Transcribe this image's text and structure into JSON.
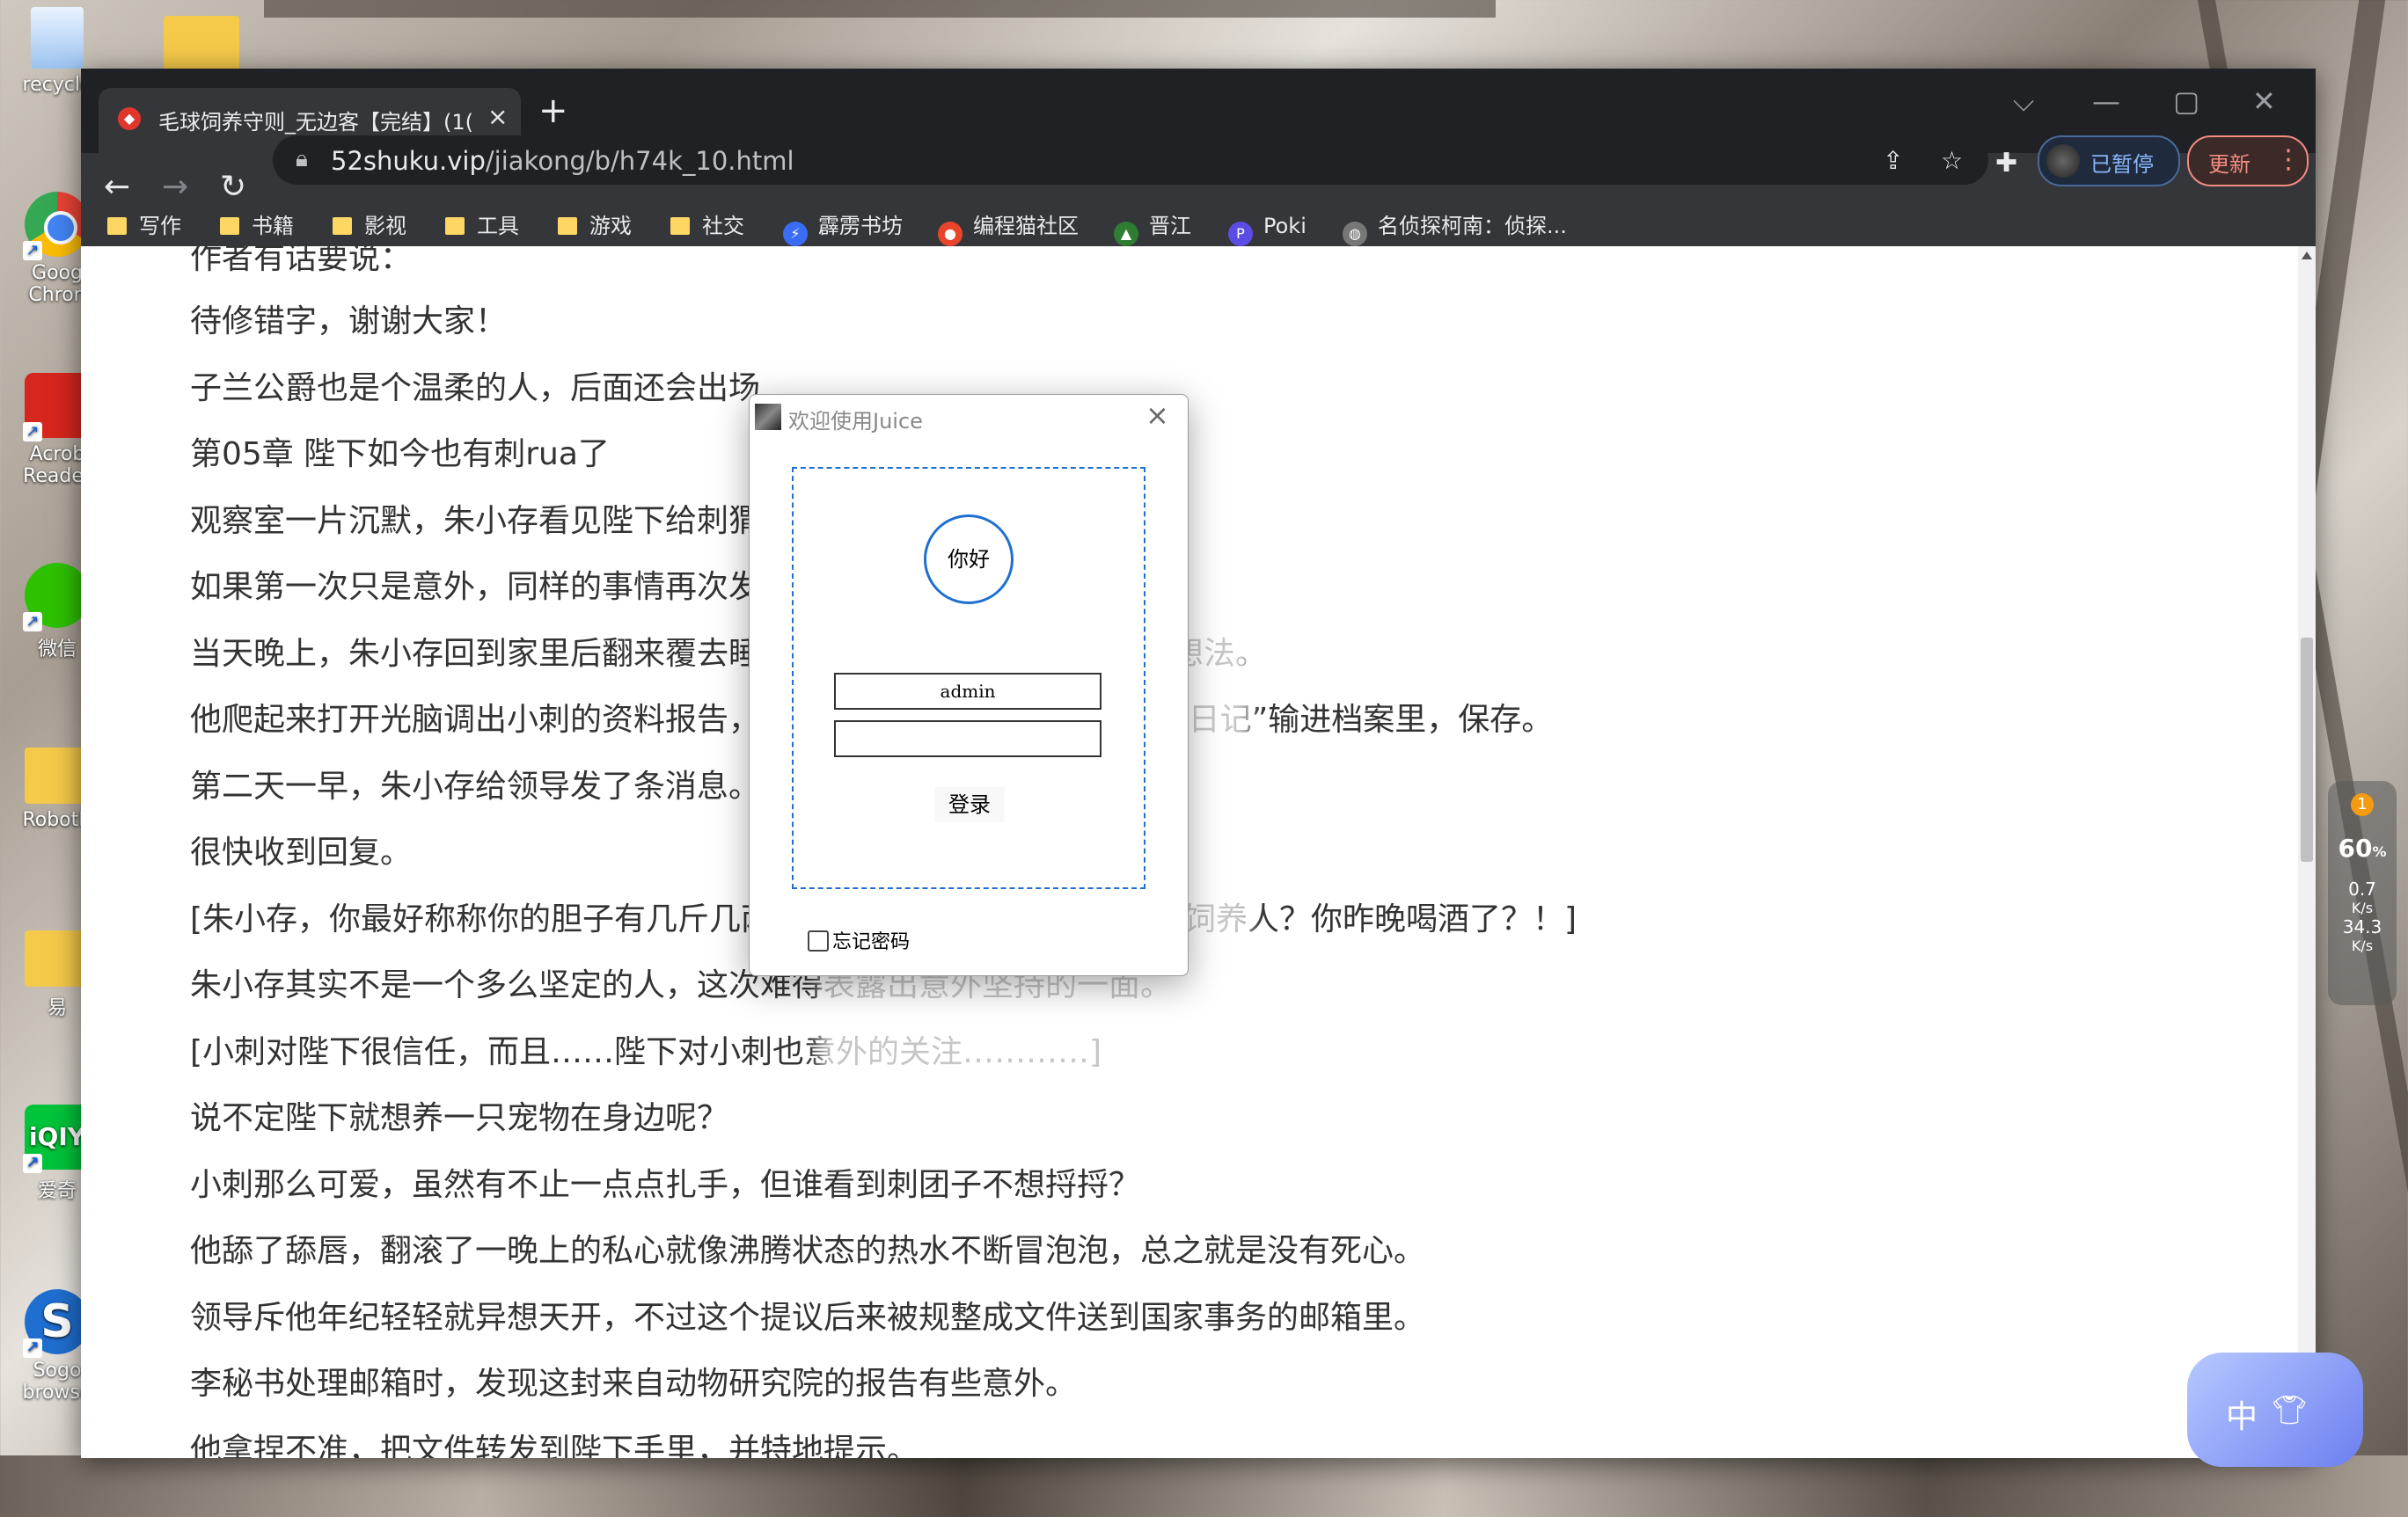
{
  "desktop": {
    "icons": [
      {
        "label": "recycle",
        "icon": "recycle-bin-icon"
      },
      {
        "label": "Goog Chron",
        "icon": "chrome-icon"
      },
      {
        "label": "Acrob Reader",
        "icon": "acrobat-icon"
      },
      {
        "label": "微信",
        "icon": "wechat-icon"
      },
      {
        "label": "RobotR",
        "icon": "folder-icon"
      },
      {
        "label": "易",
        "icon": "folder-icon"
      },
      {
        "label": "爱奇",
        "icon": "iqiyi-icon"
      },
      {
        "label": "Sogo browse",
        "icon": "sogou-icon"
      }
    ]
  },
  "browser": {
    "tab": {
      "title": "毛球饲养守则_无边客【完结】(1(",
      "close": "×"
    },
    "new_tab": "+",
    "window_controls": {
      "dropdown": "⌵",
      "minimize": "—",
      "maximize": "▢",
      "close": "✕"
    },
    "nav": {
      "back": "←",
      "forward": "→",
      "reload": "↻"
    },
    "address": {
      "host": "52shuku.vip",
      "path": "/jiakong/b/h74k_10.html"
    },
    "profile_label": "已暂停",
    "update_label": "更新",
    "bookmarks": [
      {
        "label": "写作",
        "kind": "folder"
      },
      {
        "label": "书籍",
        "kind": "folder"
      },
      {
        "label": "影视",
        "kind": "folder"
      },
      {
        "label": "工具",
        "kind": "folder"
      },
      {
        "label": "游戏",
        "kind": "folder"
      },
      {
        "label": "社交",
        "kind": "folder"
      },
      {
        "label": "霹雳书坊",
        "kind": "site",
        "color": "#3b6cf6"
      },
      {
        "label": "编程猫社区",
        "kind": "site",
        "color": "#e8452c"
      },
      {
        "label": "晋江",
        "kind": "site",
        "color": "#2e7d32"
      },
      {
        "label": "Poki",
        "kind": "site",
        "color": "#5b4ce6"
      },
      {
        "label": "名侦探柯南：侦探...",
        "kind": "site",
        "color": "#777777"
      }
    ]
  },
  "content": {
    "lines": [
      "作者有话要说：",
      "待修错字，谢谢大家！",
      "子兰公爵也是个温柔的人，后面还会出场",
      "第05章 陛下如今也有刺rua了",
      "观察室一片沉默，朱小存看见陛下给刺猬喂食再次受惊。",
      "如果第一次只是意外，同样的事情再次发生可就算不上巧合了。",
      "当天晚上，朱小存回到家里后翻来覆去睡不着，他突然做了一个大胆的想法。",
      "他爬起来打开光脑调出小刺的资料报告，把今天陛下给小刺喂食的“观察日记”输进档案里，保存。",
      "第二天一早，朱小存给领导发了条消息。",
      "很快收到回复。",
      "[朱小存，你最好称称你的胆子有几斤几两重，居然妄想让陛下做小刺的饲养人？你昨晚喝酒了？！]",
      "朱小存其实不是一个多么坚定的人，这次难得表露出意外坚持的一面。",
      "[小刺对陛下很信任，而且……陛下对小刺也意外的关注…………]",
      "说不定陛下就想养一只宠物在身边呢？",
      "小刺那么可爱，虽然有不止一点点扎手，但谁看到刺团子不想捋捋？",
      "他舔了舔唇，翻滚了一晚上的私心就像沸腾状态的热水不断冒泡泡，总之就是没有死心。",
      "领导斥他年纪轻轻就异想天开，不过这个提议后来被规整成文件送到国家事务的邮箱里。",
      "李秘书处理邮箱时，发现这封来自动物研究院的报告有些意外。",
      "他拿捏不准，把文件转发到陛下手里，并特地提示。"
    ]
  },
  "dialog": {
    "title": "欢迎使用Juice",
    "avatar_text": "你好",
    "username_value": "admin",
    "password_value": "",
    "login_label": "登录",
    "remember_label": "忘记密码",
    "remember_checked": false
  },
  "widget": {
    "badge": "1",
    "percent": "60",
    "percent_unit": "%",
    "up": "0.7",
    "up_unit": "K/s",
    "down": "34.3",
    "down_unit": "K/s"
  },
  "ime": {
    "label": "中"
  }
}
